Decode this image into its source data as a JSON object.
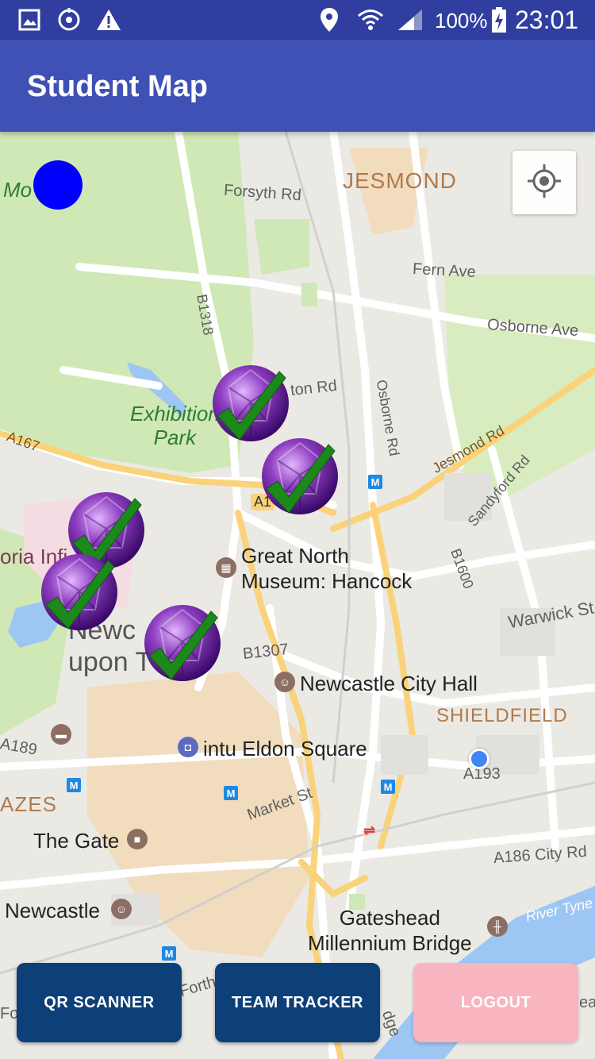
{
  "status_bar": {
    "battery": "100%",
    "time": "23:01",
    "icons": [
      "image-icon",
      "sync-icon",
      "warning-icon",
      "location-pin-icon",
      "wifi-icon",
      "signal-icon",
      "battery-charging-icon"
    ]
  },
  "app_bar": {
    "title": "Student Map"
  },
  "map": {
    "labels": {
      "jesmond": "JESMOND",
      "forsyth_rd": "Forsyth Rd",
      "fern_ave": "Fern Ave",
      "osborne_ave": "Osborne Ave",
      "b1318": "B1318",
      "ton_rd": "ton Rd",
      "osborne_rd": "Osborne Rd",
      "jesmond_rd": "Jesmond Rd",
      "sandyford_rd": "Sandyford Rd",
      "exhibition_park": "Exhibition\nPark",
      "a167": "A167",
      "a1": "A1",
      "b1600": "B1600",
      "great_north_museum": "Great North\nMuseum: Hancock",
      "oria_infi": "oria Infi",
      "warwick_st": "Warwick St",
      "newc_upon": "Newc\nupon T",
      "b1307": "B1307",
      "newcastle_city_hall": "Newcastle City Hall",
      "shieldfield": "SHIELDFIELD",
      "a189": "A189",
      "intu_eldon_square": "intu Eldon Square",
      "a193": "A193",
      "azes": "AZES",
      "market_st": "Market St",
      "the_gate": "The Gate",
      "a186_city_rd": "A186  City Rd",
      "newcastle": "Newcastle",
      "gateshead_millennium_bridge": "Gateshead\nMillennium Bridge",
      "river_tyne": "River Tyne",
      "mo": "Mo",
      "forth": "Forth",
      "for": "For",
      "dge": "dge",
      "ea": "ea"
    },
    "markers_count": 5,
    "marker_state": "completed"
  },
  "buttons": {
    "qr_scanner": "QR SCANNER",
    "team_tracker": "TEAM TRACKER",
    "logout": "LOGOUT"
  },
  "colors": {
    "status_bar": "#303f9f",
    "app_bar": "#3f51b5",
    "primary_button": "#0d3f78",
    "logout_button": "#f8b4bf",
    "check": "#1b8a1b",
    "gem": "#8e3fc1"
  }
}
